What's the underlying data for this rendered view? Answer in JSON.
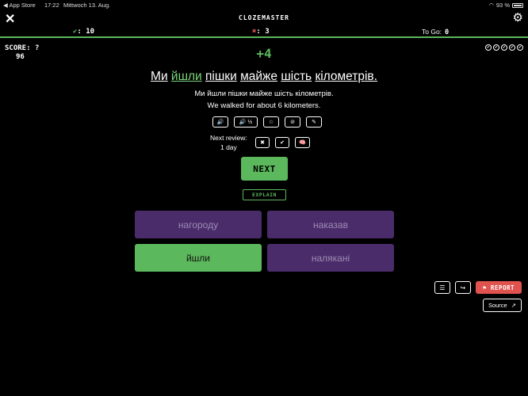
{
  "status_bar": {
    "back_app": "◀ App Store",
    "time": "17:22",
    "date": "Mittwoch 13. Aug.",
    "battery": "93 %"
  },
  "header": {
    "title": "CLOZEMASTER"
  },
  "counts": {
    "correct": "10",
    "wrong": "3",
    "to_go_label": "To Go:",
    "to_go": "0"
  },
  "score": {
    "label": "SCORE:",
    "value": "96"
  },
  "points_gained": "+4",
  "sentence": {
    "before": "Ми",
    "cloze": "йшли",
    "w2": "пішки",
    "w3": "майже",
    "w4": "шість",
    "w5": "кілометрів."
  },
  "native_sentence": "Ми йшли пішки майже шість кілометрів.",
  "translation": "We walked for about 6 kilometers.",
  "tools": {
    "half_speed": "½"
  },
  "review": {
    "label": "Next review:",
    "interval": "1 day"
  },
  "next_button": "NEXT",
  "explain_button": "EXPLAIN",
  "options": [
    "нагороду",
    "наказав",
    "йшли",
    "налякані"
  ],
  "actions": {
    "report": "REPORT",
    "source": "Source"
  },
  "colors": {
    "accent": "#5cb85c",
    "option_bg": "#4a2c6b",
    "report": "#e0534f"
  }
}
